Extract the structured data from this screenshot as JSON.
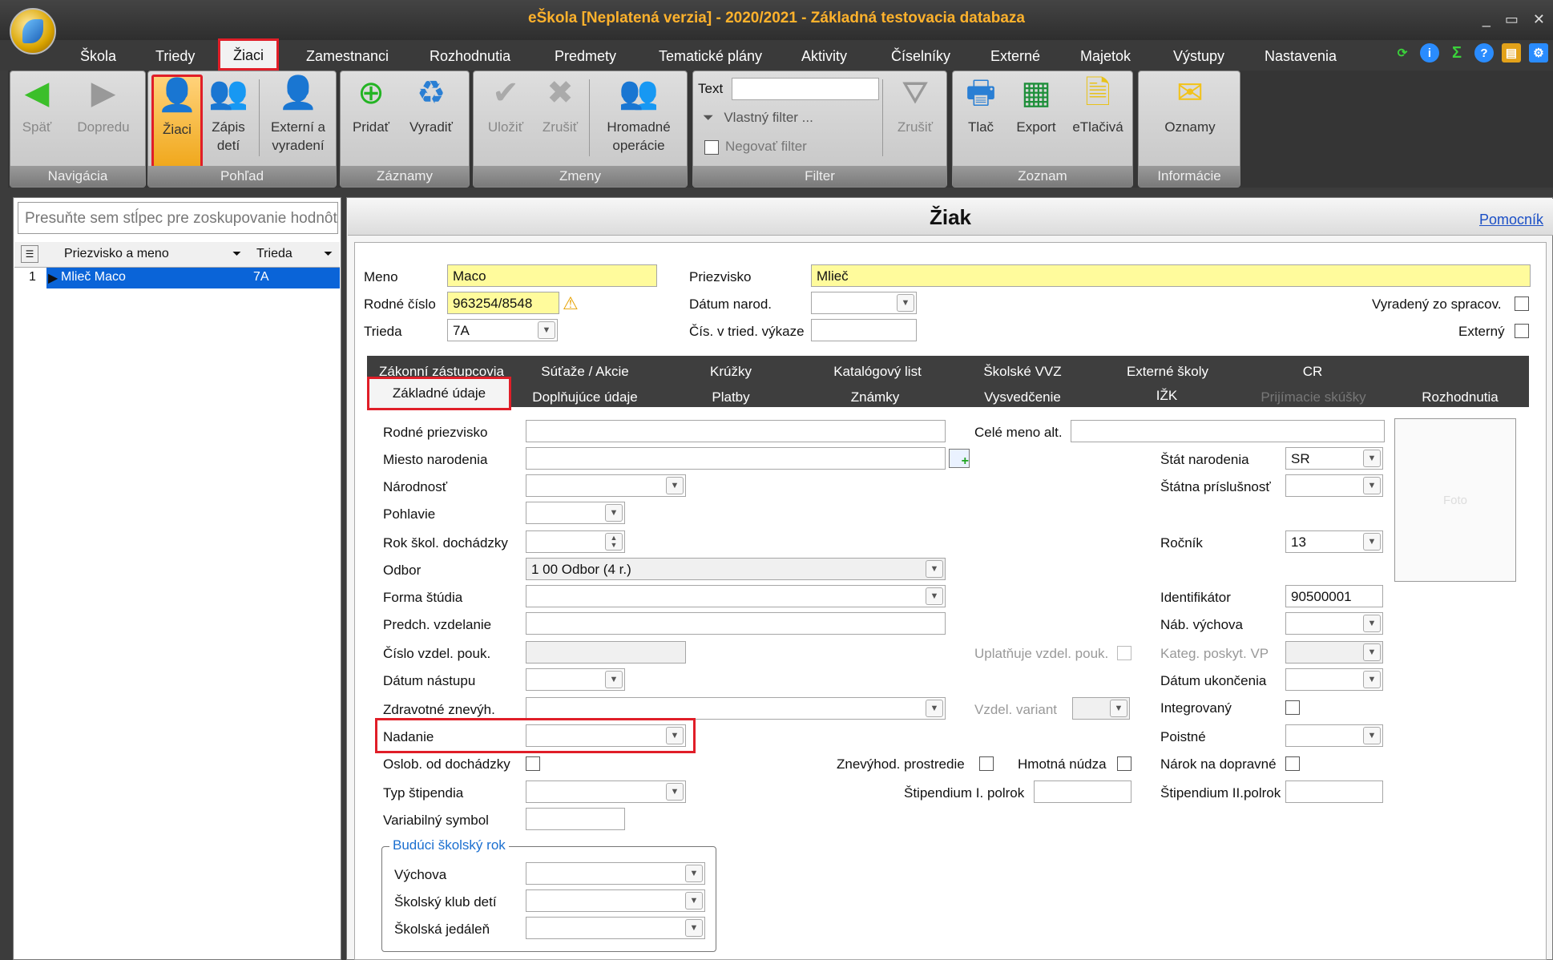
{
  "window": {
    "title": "eŠkola [Neplatená verzia] - 2020/2021 - Základná testovacia databaza"
  },
  "menu": [
    "Škola",
    "Triedy",
    "Žiaci",
    "Zamestnanci",
    "Rozhodnutia",
    "Predmety",
    "Tematické plány",
    "Aktivity",
    "Číselníky",
    "Externé",
    "Majetok",
    "Výstupy",
    "Nastavenia"
  ],
  "menu_active": "Žiaci",
  "ribbon": {
    "groups": {
      "navigacia": "Navigácia",
      "pohlad": "Pohľad",
      "zaznamy": "Záznamy",
      "zmeny": "Zmeny",
      "filter": "Filter",
      "zoznam": "Zoznam",
      "informacie": "Informácie"
    },
    "buttons": {
      "spat": "Späť",
      "dopredu": "Dopredu",
      "ziaci": "Žiaci",
      "zapis_1": "Zápis",
      "zapis_2": "detí",
      "externi_1": "Externí a",
      "externi_2": "vyradení",
      "pridat": "Pridať",
      "vyradit": "Vyradiť",
      "ulozit": "Uložiť",
      "zrusit": "Zrušiť",
      "hromadne_1": "Hromadné",
      "hromadne_2": "operácie",
      "filter_text_label": "Text",
      "filter_text_value": "",
      "vlastny_filter": "Vlastný filter ...",
      "negovat_filter": "Negovať filter",
      "filter_zrusit": "Zrušiť",
      "tlac": "Tlač",
      "export": "Export",
      "etlaciva": "eTlačivá",
      "oznamy": "Oznamy"
    }
  },
  "left": {
    "group_hint": "Presuňte sem stĺpec pre zoskupovanie hodnôt",
    "columns": [
      "Priezvisko a meno",
      "Trieda"
    ],
    "rows": [
      {
        "num": "1",
        "name": "Mlieč Maco",
        "class": "7A"
      }
    ]
  },
  "panel": {
    "title": "Žiak",
    "help": "Pomocník"
  },
  "header_form": {
    "meno_label": "Meno",
    "meno": "Maco",
    "priezvisko_label": "Priezvisko",
    "priezvisko": "Mlieč",
    "rodne_cislo_label": "Rodné číslo",
    "rodne_cislo": "963254/8548",
    "datum_narod_label": "Dátum narod.",
    "datum_narod": "",
    "vyradeny_label": "Vyradený zo spracov.",
    "trieda_label": "Trieda",
    "trieda": "7A",
    "cis_vykaz_label": "Čís. v tried. výkaze",
    "cis_vykaz": "",
    "externy_label": "Externý"
  },
  "tabs_row1": [
    "Zákonní zástupcovia",
    "Súťaže / Akcie",
    "Krúžky",
    "Katalógový list",
    "Školské VVZ",
    "Externé školy",
    "CR"
  ],
  "tabs_row2": [
    "Základné údaje",
    "Doplňujúce údaje",
    "Platby",
    "Známky",
    "Vysvedčenie",
    "IŽK",
    "Prijímacie skúšky",
    "Rozhodnutia"
  ],
  "form": {
    "rodne_priezvisko": "Rodné priezvisko",
    "cele_meno_alt": "Celé meno alt.",
    "miesto_narodenia": "Miesto narodenia",
    "stat_narodenia": "Štát narodenia",
    "stat_narodenia_val": "SR",
    "narodnost": "Národnosť",
    "statna_prislusnost": "Štátna príslušnosť",
    "pohlavie": "Pohlavie",
    "rok_skol_dochadzky": "Rok škol. dochádzky",
    "rocnik": "Ročník",
    "rocnik_val": "13",
    "odbor": "Odbor",
    "odbor_val": "1 00 Odbor (4 r.)",
    "forma_studia": "Forma štúdia",
    "identifikator": "Identifikátor",
    "identifikator_val": "90500001",
    "predch_vzdelanie": "Predch. vzdelanie",
    "nab_vychova": "Náb. výchova",
    "cislo_vzdel_pouk": "Číslo vzdel. pouk.",
    "uplatnuje_vzdel_pouk": "Uplatňuje vzdel. pouk.",
    "kateg_poskyt_vp": "Kateg. poskyt. VP",
    "datum_nastupu": "Dátum nástupu",
    "datum_ukoncenia": "Dátum ukončenia",
    "zdravotne_znevyh": "Zdravotné znevýh.",
    "vzdel_variant": "Vzdel. variant",
    "integrovany": "Integrovaný",
    "nadanie": "Nadanie",
    "poistne": "Poistné",
    "oslob_od_dochadzky": "Oslob. od dochádzky",
    "znevyhod_prostredie": "Znevýhod. prostredie",
    "hmotna_nudza": "Hmotná núdza",
    "narok_na_dopravne": "Nárok na dopravné",
    "typ_stipendia": "Typ štipendia",
    "stipendium_1": "Štipendium I. polrok",
    "stipendium_2": "Štipendium II.polrok",
    "variabilny_symbol": "Variabilný symbol",
    "foto": "Foto"
  },
  "future_year": {
    "legend": "Budúci školský rok",
    "vychova": "Výchova",
    "skolsky_klub": "Školský klub detí",
    "skolska_jedalen": "Školská jedáleň"
  }
}
